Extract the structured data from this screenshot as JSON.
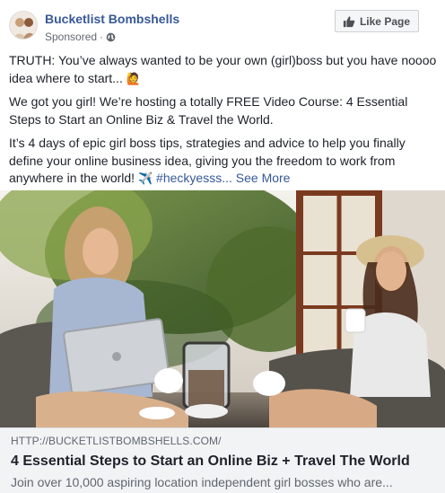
{
  "header": {
    "page_name": "Bucketlist Bombshells",
    "sponsored_label": "Sponsored",
    "separator": "·",
    "globe_icon": "globe-icon",
    "like_button_label": "Like Page",
    "like_icon": "thumbs-up-icon"
  },
  "post": {
    "paragraph_1": "TRUTH: You’ve always wanted to be your own (girl)boss but you have noooo idea where to start...",
    "paragraph_1_emoji": "🙋",
    "paragraph_2": "We got you girl! We’re hosting a totally FREE Video Course: 4 Essential Steps to Start an Online Biz & Travel the World.",
    "paragraph_3": "It’s 4 days of epic girl boss tips, strategies and advice to help you finally define your online business idea, giving you the freedom to work from anywhere in the world!",
    "paragraph_3_emoji": "✈️",
    "hashtag": "#heckyesss...",
    "see_more": "See More"
  },
  "link_preview": {
    "domain": "HTTP://BUCKETLISTBOMBSHELLS.COM/",
    "title": "4 Essential Steps to Start an Online Biz + Travel The World",
    "description": "Join over 10,000 aspiring location independent girl bosses who are..."
  },
  "colors": {
    "page_name": "#385898",
    "link_blue": "#365899",
    "preview_bg": "#f2f3f5"
  }
}
